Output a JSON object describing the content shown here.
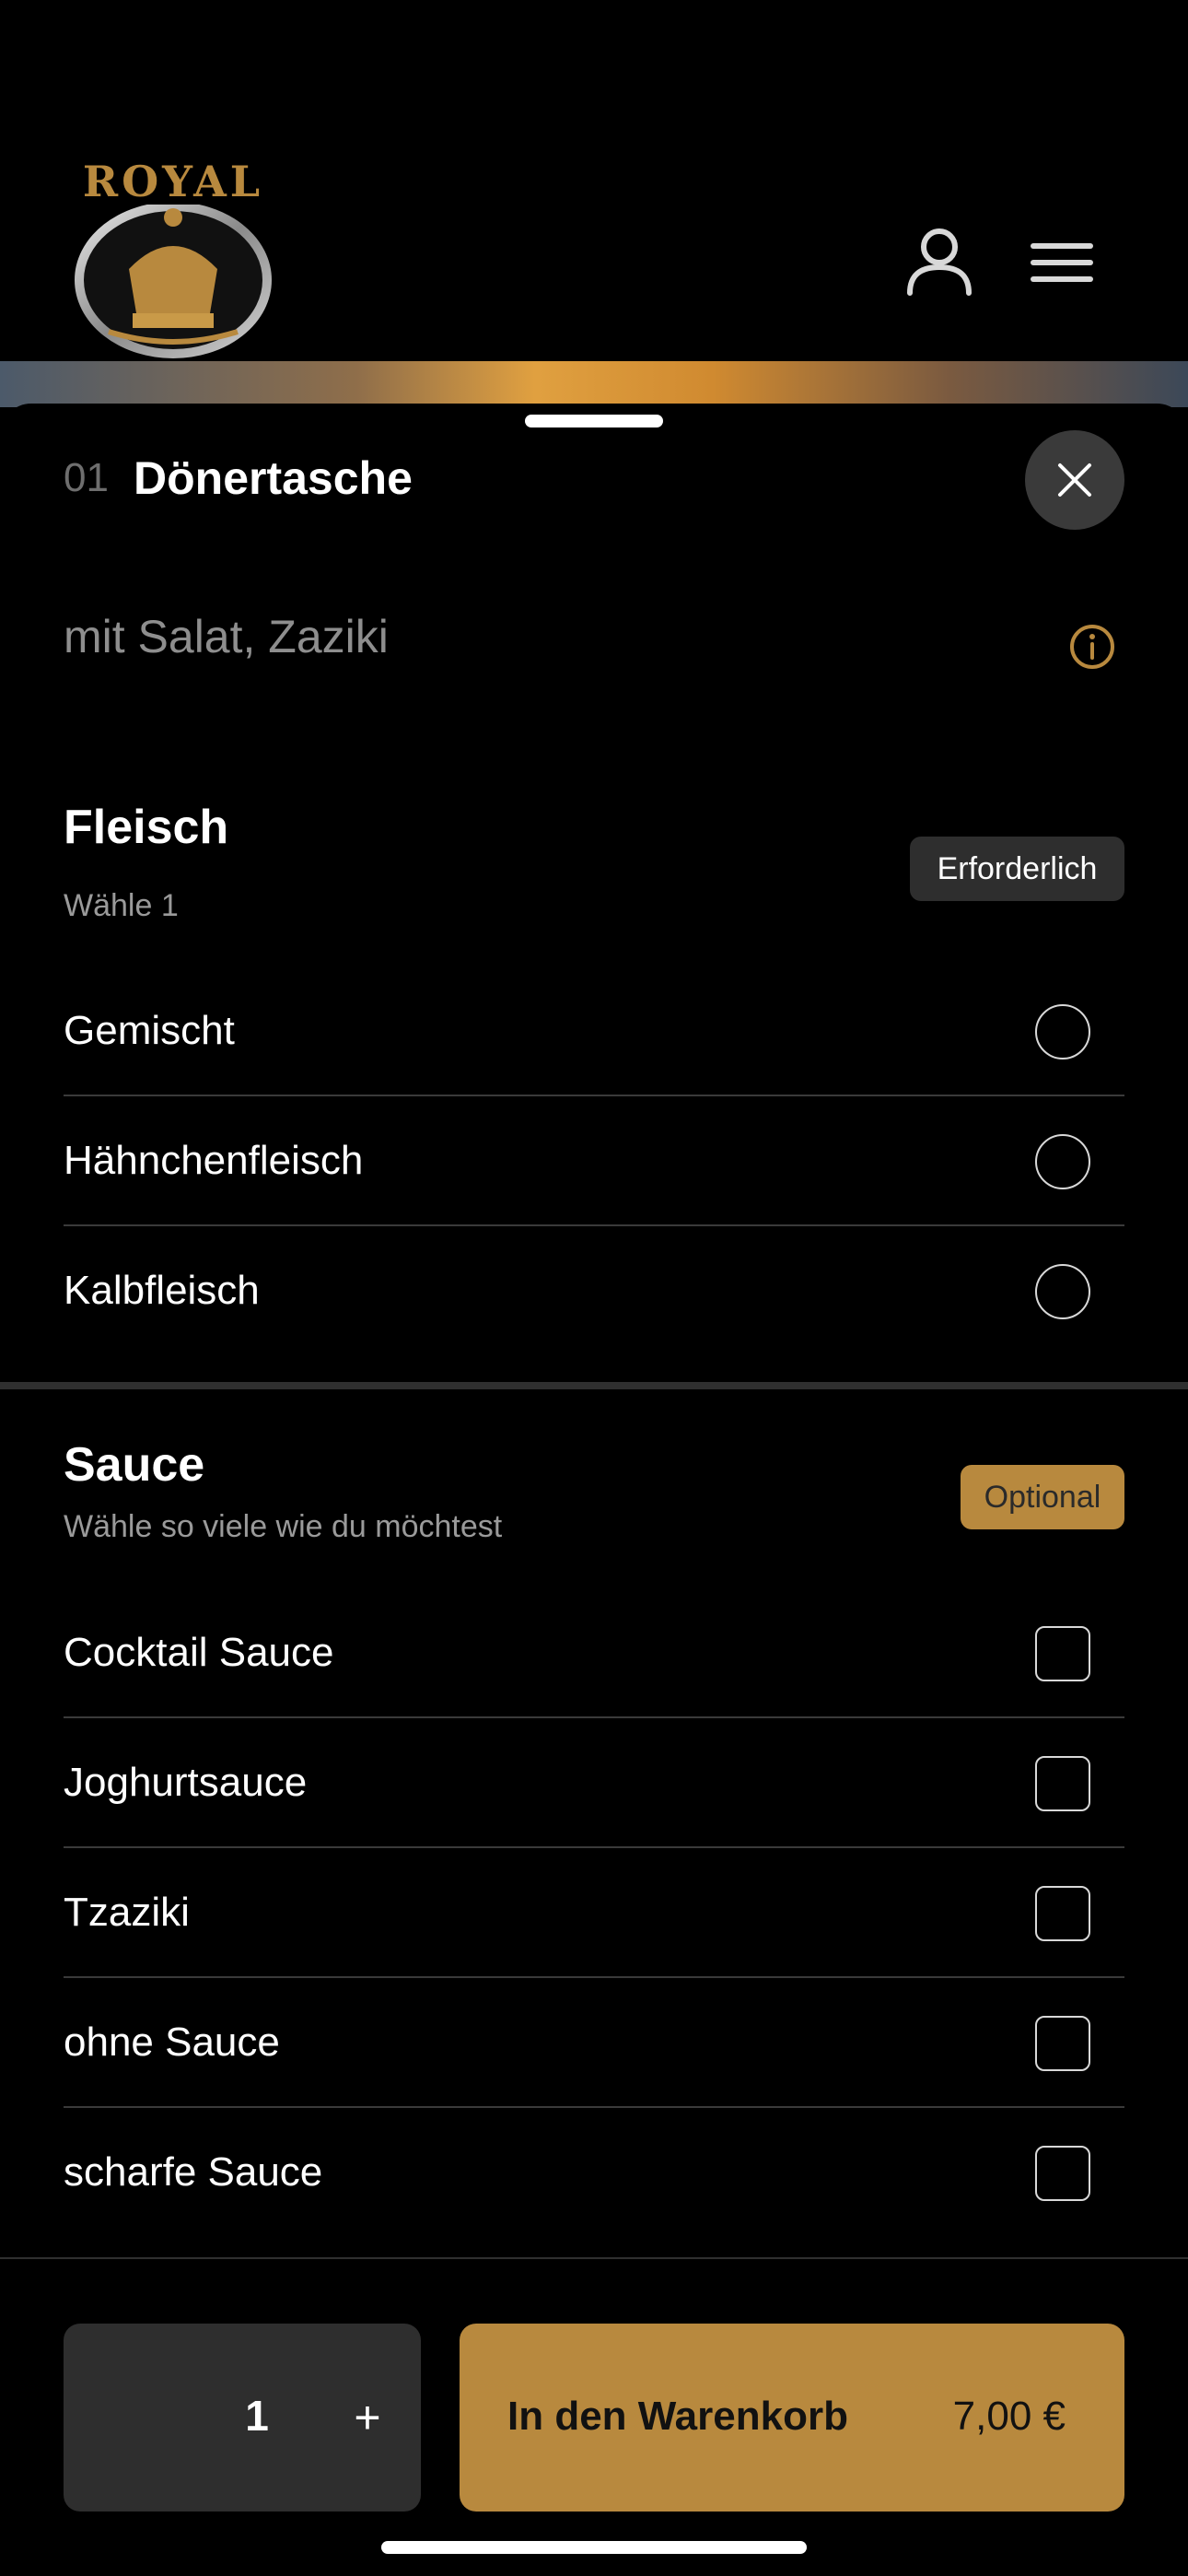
{
  "header": {
    "logo_text": "ROYAL",
    "icons": [
      "user-icon",
      "menu-icon"
    ]
  },
  "item": {
    "number": "01",
    "title": "Dönertasche",
    "description": "mit Salat, Zaziki"
  },
  "groups": {
    "fleisch": {
      "title": "Fleisch",
      "subtitle": "Wähle 1",
      "badge": "Erforderlich",
      "options": [
        "Gemischt",
        "Hähnchenfleisch",
        "Kalbfleisch"
      ]
    },
    "sauce": {
      "title": "Sauce",
      "subtitle": "Wähle so viele wie du möchtest",
      "badge": "Optional",
      "options": [
        "Cocktail Sauce",
        "Joghurtsauce",
        "Tzaziki",
        "ohne Sauce",
        "scharfe Sauce"
      ]
    }
  },
  "footer": {
    "quantity": "1",
    "plus": "+",
    "cart_label": "In den Warenkorb",
    "price": "7,00 €"
  },
  "colors": {
    "accent": "#b8893e",
    "background": "#000000",
    "surface": "#2e2e2e"
  }
}
